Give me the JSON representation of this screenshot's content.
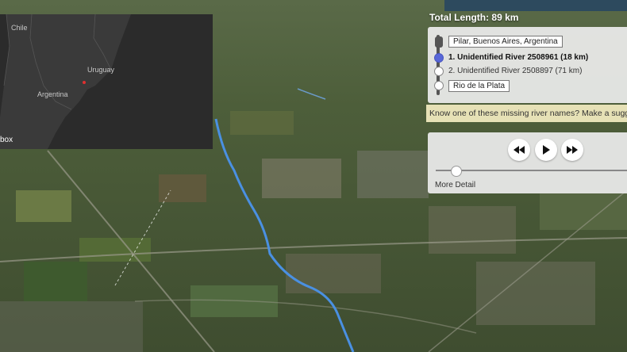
{
  "colors": {
    "river": "#4a90e2",
    "active_dot": "#5867d8",
    "suggest_bg": "#e6e1b6"
  },
  "minimap": {
    "labels": {
      "chile": "Chile",
      "uruguay": "Uruguay",
      "argentina": "Argentina"
    },
    "attribution": "box"
  },
  "route": {
    "total_length": "Total Length: 89 km",
    "start_place": "Pilar, Buenos Aires, Argentina",
    "rivers": [
      {
        "label": "1. Unidentified River 2508961 (18 km)",
        "active": true
      },
      {
        "label": "2. Unidentified River 2508897 (71 km)",
        "active": false
      }
    ],
    "end_place": "Rio de la Plata",
    "suggest_text": "Know one of these missing river names? Make a suggestion"
  },
  "player": {
    "rewind_icon": "rewind-icon",
    "play_icon": "play-icon",
    "forward_icon": "fast-forward-icon",
    "progress": 0.1,
    "more_detail_label": "More Detail"
  }
}
